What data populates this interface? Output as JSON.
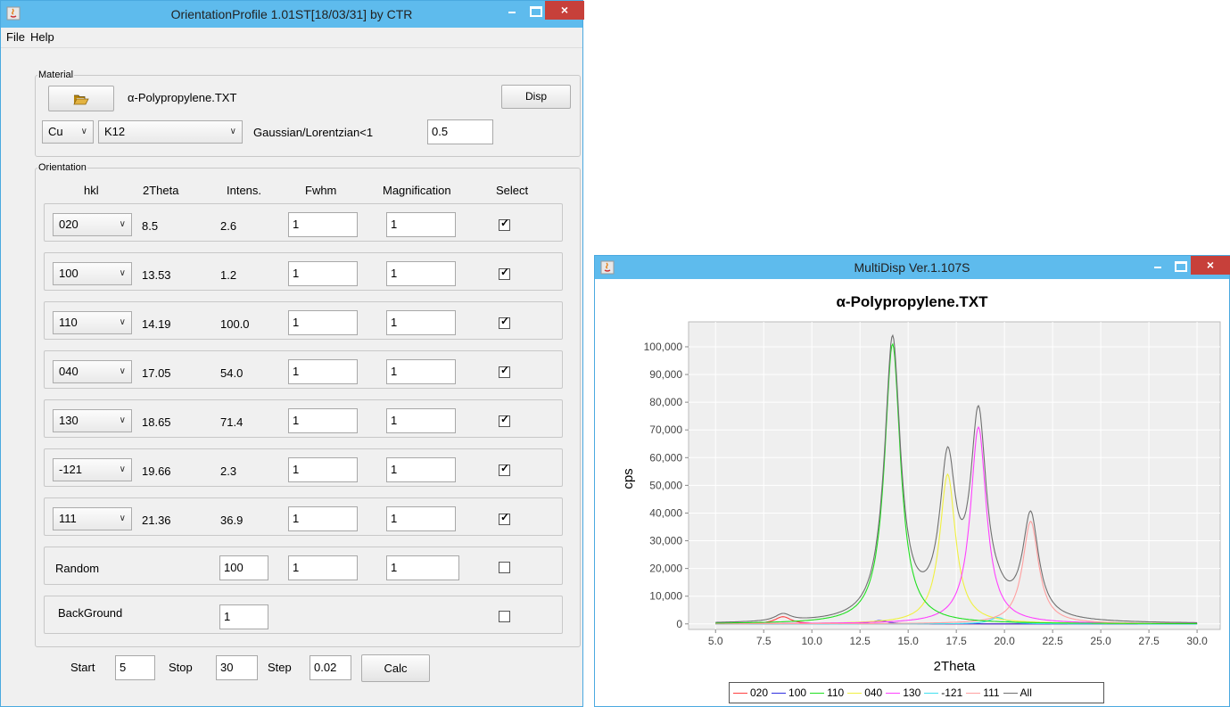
{
  "left_window": {
    "title": "OrientationProfile 1.01ST[18/03/31] by CTR",
    "close_glyph": "×",
    "menu": [
      "File",
      "Help"
    ],
    "material": {
      "legend": "Material",
      "open_icon": "folder-open-icon",
      "file_name": "α-Polypropylene.TXT",
      "disp_label": "Disp",
      "target": "Cu",
      "line": "K12",
      "ratio_label": "Gaussian/Lorentzian<1",
      "ratio_value": "0.5"
    },
    "orientation": {
      "legend": "Orientation",
      "headers": [
        "hkl",
        "2Theta",
        "Intens.",
        "Fwhm",
        "Magnification",
        "Select"
      ],
      "rows": [
        {
          "hkl": "020",
          "theta": "8.5",
          "intens": "2.6",
          "fwhm": "1",
          "mag": "1",
          "selected": true
        },
        {
          "hkl": "100",
          "theta": "13.53",
          "intens": "1.2",
          "fwhm": "1",
          "mag": "1",
          "selected": true
        },
        {
          "hkl": "110",
          "theta": "14.19",
          "intens": "100.0",
          "fwhm": "1",
          "mag": "1",
          "selected": true
        },
        {
          "hkl": "040",
          "theta": "17.05",
          "intens": "54.0",
          "fwhm": "1",
          "mag": "1",
          "selected": true
        },
        {
          "hkl": "130",
          "theta": "18.65",
          "intens": "71.4",
          "fwhm": "1",
          "mag": "1",
          "selected": true
        },
        {
          "hkl": "-121",
          "theta": "19.66",
          "intens": "2.3",
          "fwhm": "1",
          "mag": "1",
          "selected": true
        },
        {
          "hkl": "111",
          "theta": "21.36",
          "intens": "36.9",
          "fwhm": "1",
          "mag": "1",
          "selected": true
        }
      ],
      "random": {
        "label": "Random",
        "intens": "100",
        "fwhm": "1",
        "mag": "1",
        "selected": false
      },
      "background": {
        "label": "BackGround",
        "value": "1",
        "selected": false
      }
    },
    "range": {
      "start_label": "Start",
      "start": "5",
      "stop_label": "Stop",
      "stop": "30",
      "step_label": "Step",
      "step": "0.02",
      "calc_label": "Calc"
    }
  },
  "right_window": {
    "title": "MultiDisp Ver.1.107S",
    "close_glyph": "×"
  },
  "chart_data": {
    "type": "line",
    "title": "α-Polypropylene.TXT",
    "xlabel": "2Theta",
    "ylabel": "cps",
    "xlim": [
      3.6,
      31.2
    ],
    "ylim": [
      -2000,
      109000
    ],
    "x_ticks": [
      "5.0",
      "7.5",
      "10.0",
      "12.5",
      "15.0",
      "17.5",
      "20.0",
      "22.5",
      "25.0",
      "27.5",
      "30.0"
    ],
    "y_ticks": [
      "0",
      "10,000",
      "20,000",
      "30,000",
      "40,000",
      "50,000",
      "60,000",
      "70,000",
      "80,000",
      "90,000",
      "100,000"
    ],
    "grid": true,
    "legend_position": "bottom",
    "x_range": [
      5,
      30
    ],
    "series": [
      {
        "name": "020",
        "color": "#ff4040",
        "peak_x": 8.5,
        "peak_y": 2600
      },
      {
        "name": "100",
        "color": "#3030e0",
        "peak_x": 13.53,
        "peak_y": 1200
      },
      {
        "name": "110",
        "color": "#20e020",
        "peak_x": 14.19,
        "peak_y": 101000
      },
      {
        "name": "040",
        "color": "#f0f040",
        "peak_x": 17.05,
        "peak_y": 54000
      },
      {
        "name": "130",
        "color": "#ff40ff",
        "peak_x": 18.65,
        "peak_y": 71000
      },
      {
        "name": "-121",
        "color": "#40e0f0",
        "peak_x": 19.66,
        "peak_y": 2300
      },
      {
        "name": "111",
        "color": "#ffa0a0",
        "peak_x": 21.36,
        "peak_y": 37000
      },
      {
        "name": "All",
        "color": "#707070",
        "sum_of_above": true
      }
    ],
    "peak_halfwidth": 0.5
  }
}
